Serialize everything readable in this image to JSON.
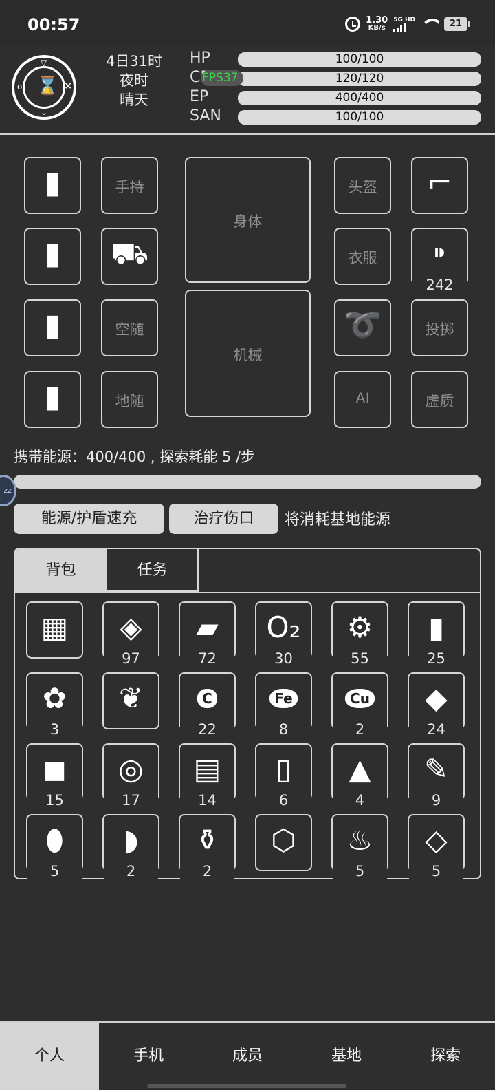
{
  "status_bar": {
    "time": "00:57",
    "speed_value": "1.30",
    "speed_unit": "KB/s",
    "network": "5G HD",
    "battery": "21",
    "icons": [
      "alarm-icon",
      "signal-icon",
      "wifi-icon",
      "battery-icon"
    ]
  },
  "header": {
    "emblem": {
      "left": "o",
      "right": "×",
      "center": "⌛"
    },
    "date": "4日31时",
    "period": "夜时",
    "weather": "晴天",
    "fps": "FPS37",
    "stats": [
      {
        "label": "HP",
        "value": "100/100",
        "fill": 1.0
      },
      {
        "label": "CP",
        "value": "120/120",
        "fill": 1.0
      },
      {
        "label": "EP",
        "value": "400/400",
        "fill": 1.0
      },
      {
        "label": "SAN",
        "value": "100/100",
        "fill": 1.0
      }
    ]
  },
  "equipment": {
    "battery_slots": [
      "battery-icon",
      "battery-icon",
      "battery-icon",
      "battery-icon"
    ],
    "hand": "手持",
    "backpack_icon": "backpack-icon",
    "air_follower": "空随",
    "ground_follower": "地随",
    "body": "身体",
    "mech": "机械",
    "helmet": "头盔",
    "clothes": "衣服",
    "armband_icon": "armband-icon",
    "ai": "AI",
    "gun_icon": "gun-icon",
    "ammo_icon": "ammo-icon",
    "ammo_count": "242",
    "throw": "投掷",
    "void": "虚质"
  },
  "energy": {
    "text": "携带能源：400/400 , 探索耗能 5 /步",
    "fill": 1.0,
    "float_ball": "zz"
  },
  "actions": {
    "quick_charge": "能源/护盾速充",
    "heal": "治疗伤口",
    "note": "将消耗基地能源"
  },
  "inventory": {
    "tabs": [
      "背包",
      "任务"
    ],
    "items": [
      {
        "icon": "window-icon",
        "glyph": "▦",
        "count": ""
      },
      {
        "icon": "food-pack-icon",
        "glyph": "◈",
        "count": "97"
      },
      {
        "icon": "box-icon",
        "glyph": "▰",
        "count": "72"
      },
      {
        "icon": "oxygen-tank-icon",
        "glyph": "O₂",
        "count": "30"
      },
      {
        "icon": "gear-parts-icon",
        "glyph": "⚙",
        "count": "55"
      },
      {
        "icon": "log-icon",
        "glyph": "▮",
        "count": "25"
      },
      {
        "icon": "rose-icon",
        "glyph": "✿",
        "count": "3"
      },
      {
        "icon": "plant-icon",
        "glyph": "❦",
        "count": ""
      },
      {
        "icon": "carbon-ore-icon",
        "glyph": "C",
        "count": "22"
      },
      {
        "icon": "iron-ore-icon",
        "glyph": "Fe",
        "count": "8"
      },
      {
        "icon": "copper-ore-icon",
        "glyph": "Cu",
        "count": "2"
      },
      {
        "icon": "rock-icon",
        "glyph": "◆",
        "count": "24"
      },
      {
        "icon": "cube-icon",
        "glyph": "◼",
        "count": "15"
      },
      {
        "icon": "pipes-icon",
        "glyph": "◎",
        "count": "17"
      },
      {
        "icon": "bricks-icon",
        "glyph": "▤",
        "count": "14"
      },
      {
        "icon": "cloth-roll-icon",
        "glyph": "▯",
        "count": "6"
      },
      {
        "icon": "tent-icon",
        "glyph": "▲",
        "count": "4"
      },
      {
        "icon": "syringe-icon",
        "glyph": "✎",
        "count": "9"
      },
      {
        "icon": "seed-icon",
        "glyph": "⬮",
        "count": "5"
      },
      {
        "icon": "meat-icon",
        "glyph": "◗",
        "count": "2"
      },
      {
        "icon": "bottle-icon",
        "glyph": "⚱",
        "count": "2"
      },
      {
        "icon": "molecule-icon",
        "glyph": "⬡",
        "count": ""
      },
      {
        "icon": "herb-icon",
        "glyph": "♨",
        "count": "5"
      },
      {
        "icon": "crystal-icon",
        "glyph": "◇",
        "count": "5"
      }
    ]
  },
  "bottom_nav": [
    "个人",
    "手机",
    "成员",
    "基地",
    "探索"
  ]
}
